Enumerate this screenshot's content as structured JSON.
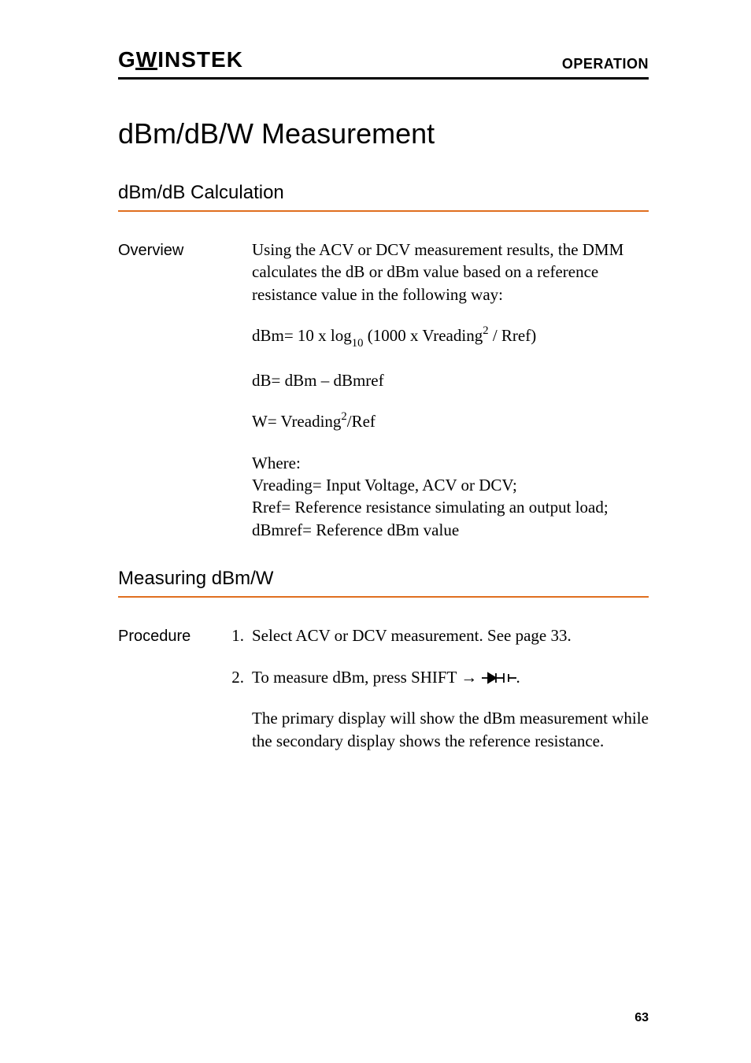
{
  "header": {
    "logo_text": "GWINSTEK",
    "section": "OPERATION"
  },
  "title": "dBm/dB/W Measurement",
  "section1": {
    "heading": "dBm/dB Calculation",
    "overview_label": "Overview",
    "overview_body": "Using the ACV or DCV measurement results, the DMM calculates the dB or dBm value based on a reference resistance value in the following way:",
    "formula_dbm_pre": "dBm= 10 x log",
    "formula_dbm_sub": "10",
    "formula_dbm_mid": " (1000 x Vreading",
    "formula_dbm_sup": "2",
    "formula_dbm_post": " / Rref)",
    "formula_db": "dB= dBm – dBmref",
    "formula_w_pre": "W= Vreading",
    "formula_w_sup": "2",
    "formula_w_post": "/Ref",
    "where_heading": "Where:",
    "where_vreading": "Vreading= Input Voltage, ACV or DCV;",
    "where_rref": "Rref= Reference resistance simulating an output load;",
    "where_dbmref": "dBmref= Reference dBm value"
  },
  "section2": {
    "heading": "Measuring dBm/W",
    "procedure_label": "Procedure",
    "steps": [
      "Select ACV or DCV measurement. See page 33.",
      "To measure dBm, press SHIFT → "
    ],
    "step2_icon_name": "diode-capacitor-icon",
    "step2_post": ".",
    "step2_note": "The primary display will show the dBm measurement while the secondary display shows the reference resistance."
  },
  "page_number": "63",
  "chart_data": {
    "type": "table",
    "title": "dBm/dB/W formulas",
    "rows": [
      {
        "label": "dBm",
        "expression": "10 × log10(1000 × Vreading^2 / Rref)"
      },
      {
        "label": "dB",
        "expression": "dBm − dBmref"
      },
      {
        "label": "W",
        "expression": "Vreading^2 / Ref"
      }
    ],
    "definitions": {
      "Vreading": "Input Voltage, ACV or DCV",
      "Rref": "Reference resistance simulating an output load",
      "dBmref": "Reference dBm value"
    }
  }
}
